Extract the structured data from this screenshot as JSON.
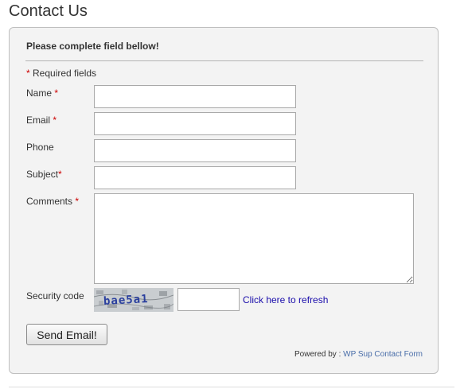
{
  "page": {
    "title": "Contact Us"
  },
  "form": {
    "heading": "Please complete field bellow!",
    "required_asterisk": "*",
    "required_note": "Required fields",
    "fields": {
      "name": {
        "label": "Name",
        "required": "*",
        "value": ""
      },
      "email": {
        "label": "Email",
        "required": "*",
        "value": ""
      },
      "phone": {
        "label": "Phone",
        "value": ""
      },
      "subject": {
        "label": "Subject",
        "required": "*",
        "value": ""
      },
      "comments": {
        "label": "Comments",
        "required": "*",
        "value": ""
      }
    },
    "security": {
      "label": "Security code",
      "captcha_text": "bae5a1",
      "value": "",
      "refresh_link": "Click here to refresh"
    },
    "submit_label": "Send Email!",
    "footer": {
      "powered_prefix": "Powered by :",
      "powered_link": "WP Sup Contact Form"
    }
  },
  "colors": {
    "required_asterisk": "#cc0000",
    "link": "#1a0dab",
    "footer_link": "#4a6ea9",
    "panel_background": "#f3f3f3"
  }
}
